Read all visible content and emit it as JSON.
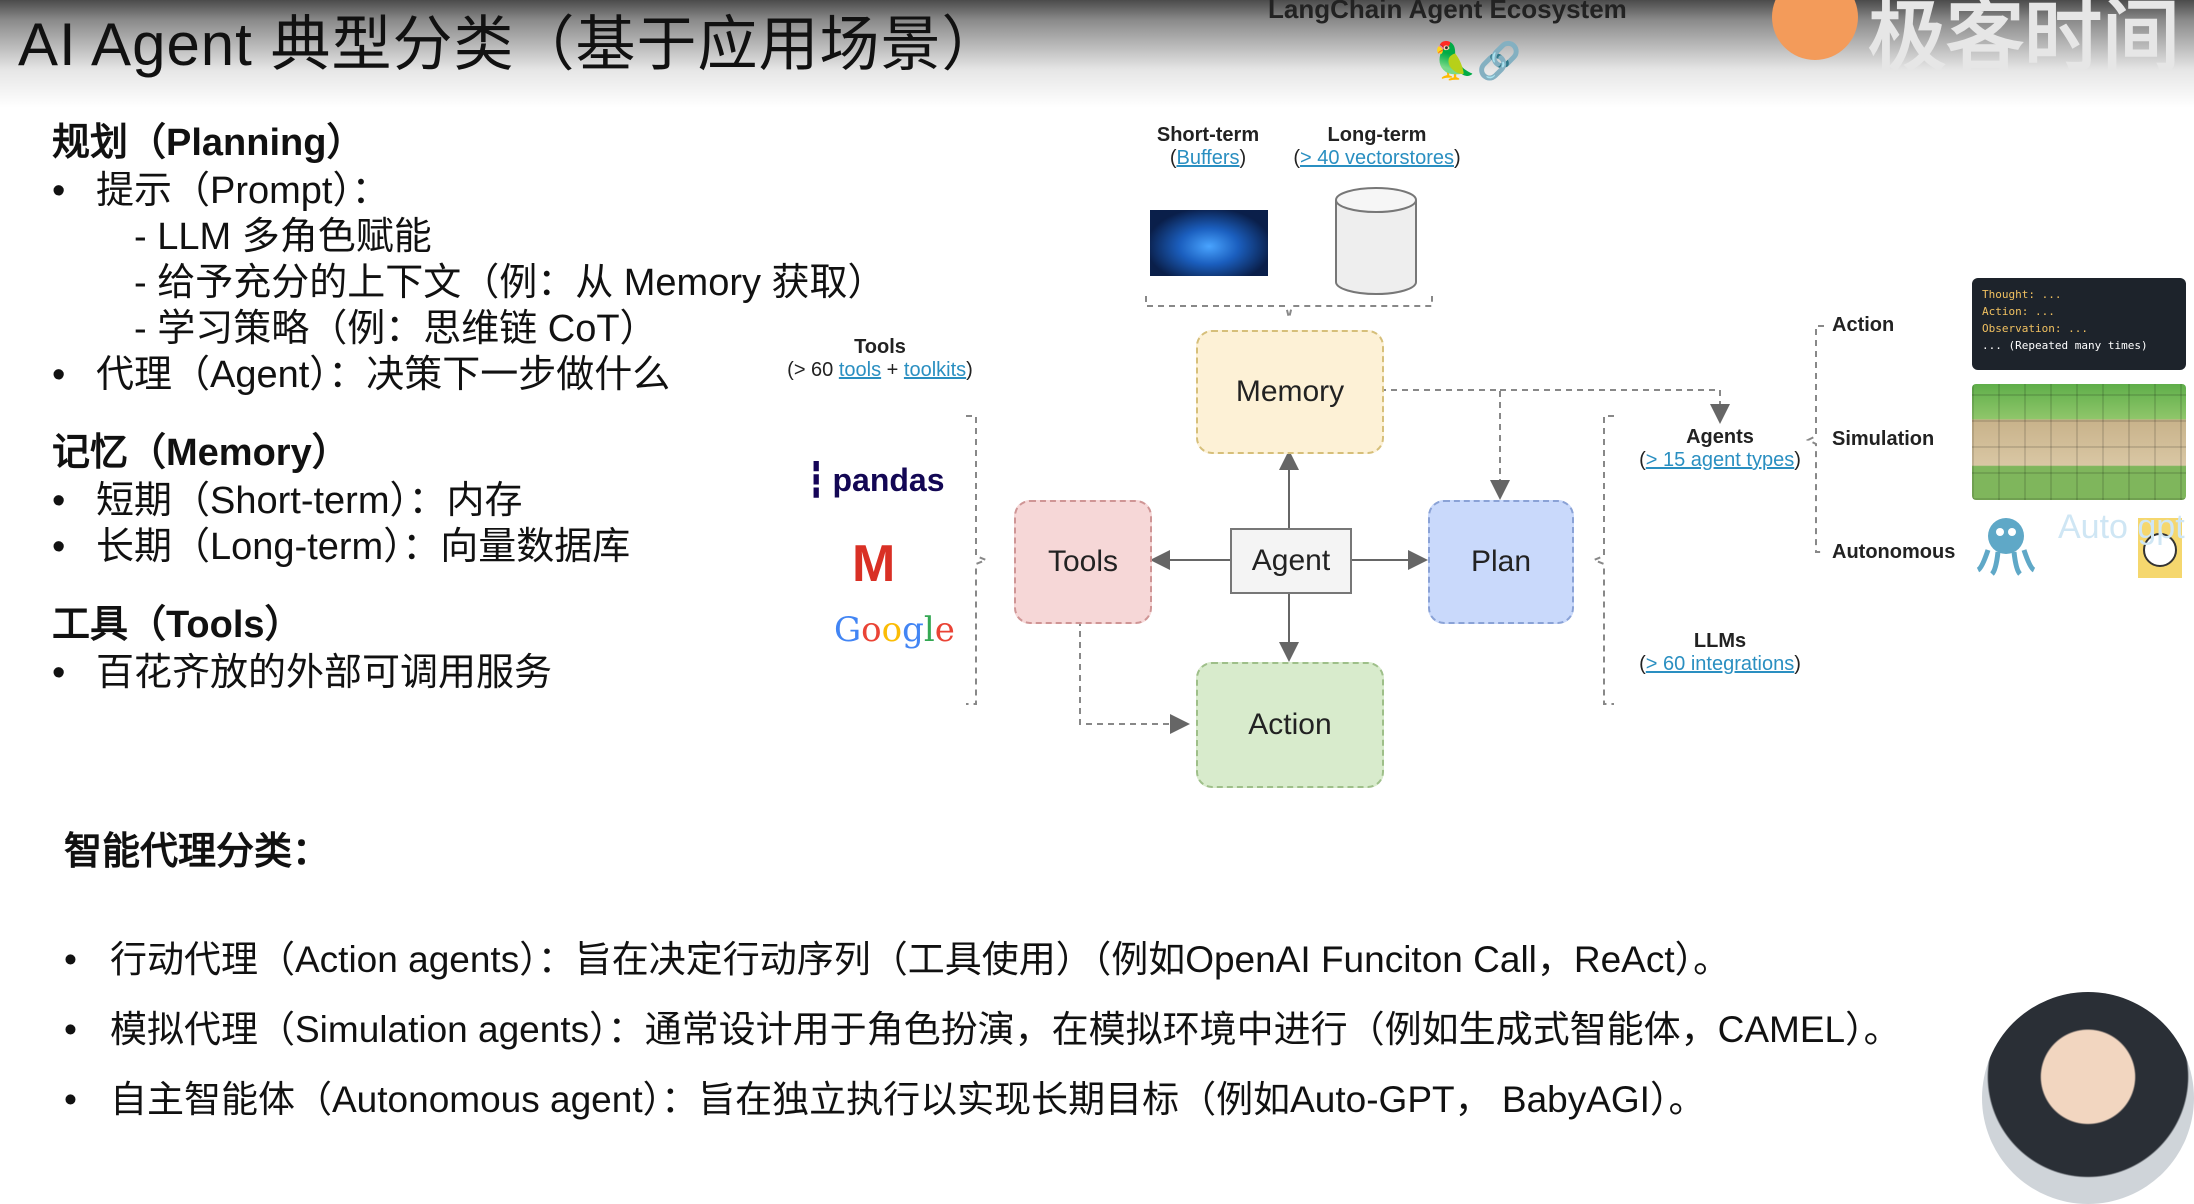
{
  "header": {
    "title": "AI Agent 典型分类（基于应用场景）",
    "ecosystem_title": "LangChain Agent Ecosystem",
    "ecosystem_emoji": "🦜🔗",
    "brand_text": "极客时间"
  },
  "left": {
    "planning": {
      "title": "规划（Planning）",
      "prompt": "提示（Prompt）：",
      "prompt_items": [
        "- LLM 多角色赋能",
        "- 给予充分的上下文（例：从 Memory 获取）",
        "- 学习策略（例：思维链 CoT）"
      ],
      "agent": "代理（Agent）：决策下一步做什么"
    },
    "memory": {
      "title": "记忆（Memory）",
      "items": [
        "短期（Short-term）：内存",
        "长期（Long-term）：向量数据库"
      ]
    },
    "tools": {
      "title": "工具（Tools）",
      "items": [
        "百花齐放的外部可调用服务"
      ]
    }
  },
  "agent_types": {
    "header": "智能代理分类：",
    "items": [
      "行动代理（Action agents）：旨在决定行动序列（工具使用）（例如OpenAI Funciton Call，ReAct）。",
      "模拟代理（Simulation agents）：通常设计用于角色扮演，在模拟环境中进行（例如生成式智能体，CAMEL）。",
      "自主智能体（Autonomous agent）：旨在独立执行以实现长期目标（例如Auto-GPT， BabyAGI）。"
    ]
  },
  "diagram": {
    "nodes": {
      "memory": "Memory",
      "tools": "Tools",
      "agent": "Agent",
      "plan": "Plan",
      "action": "Action"
    },
    "short_term": {
      "label": "Short-term",
      "link": "Buffers"
    },
    "long_term": {
      "label": "Long-term",
      "link": "> 40 vectorstores"
    },
    "tools_label": {
      "label": "Tools",
      "prefix": "(> 60 ",
      "link1": "tools",
      "plus": " + ",
      "link2": "toolkits",
      "suffix": ")"
    },
    "tool_logos": {
      "pandas": "pandas",
      "gmail": "M",
      "google": "Google"
    },
    "agents_label": {
      "label": "Agents",
      "link": "> 15 agent types"
    },
    "llms_label": {
      "label": "LLMs",
      "link": "> 60 integrations"
    },
    "agent_kinds": [
      "Action",
      "Simulation",
      "Autonomous"
    ],
    "code_example": [
      "Thought: ...",
      "Action: ...",
      "Observation: ...",
      "... (Repeated many times)"
    ],
    "autogpt_text": "Auto gpt"
  }
}
